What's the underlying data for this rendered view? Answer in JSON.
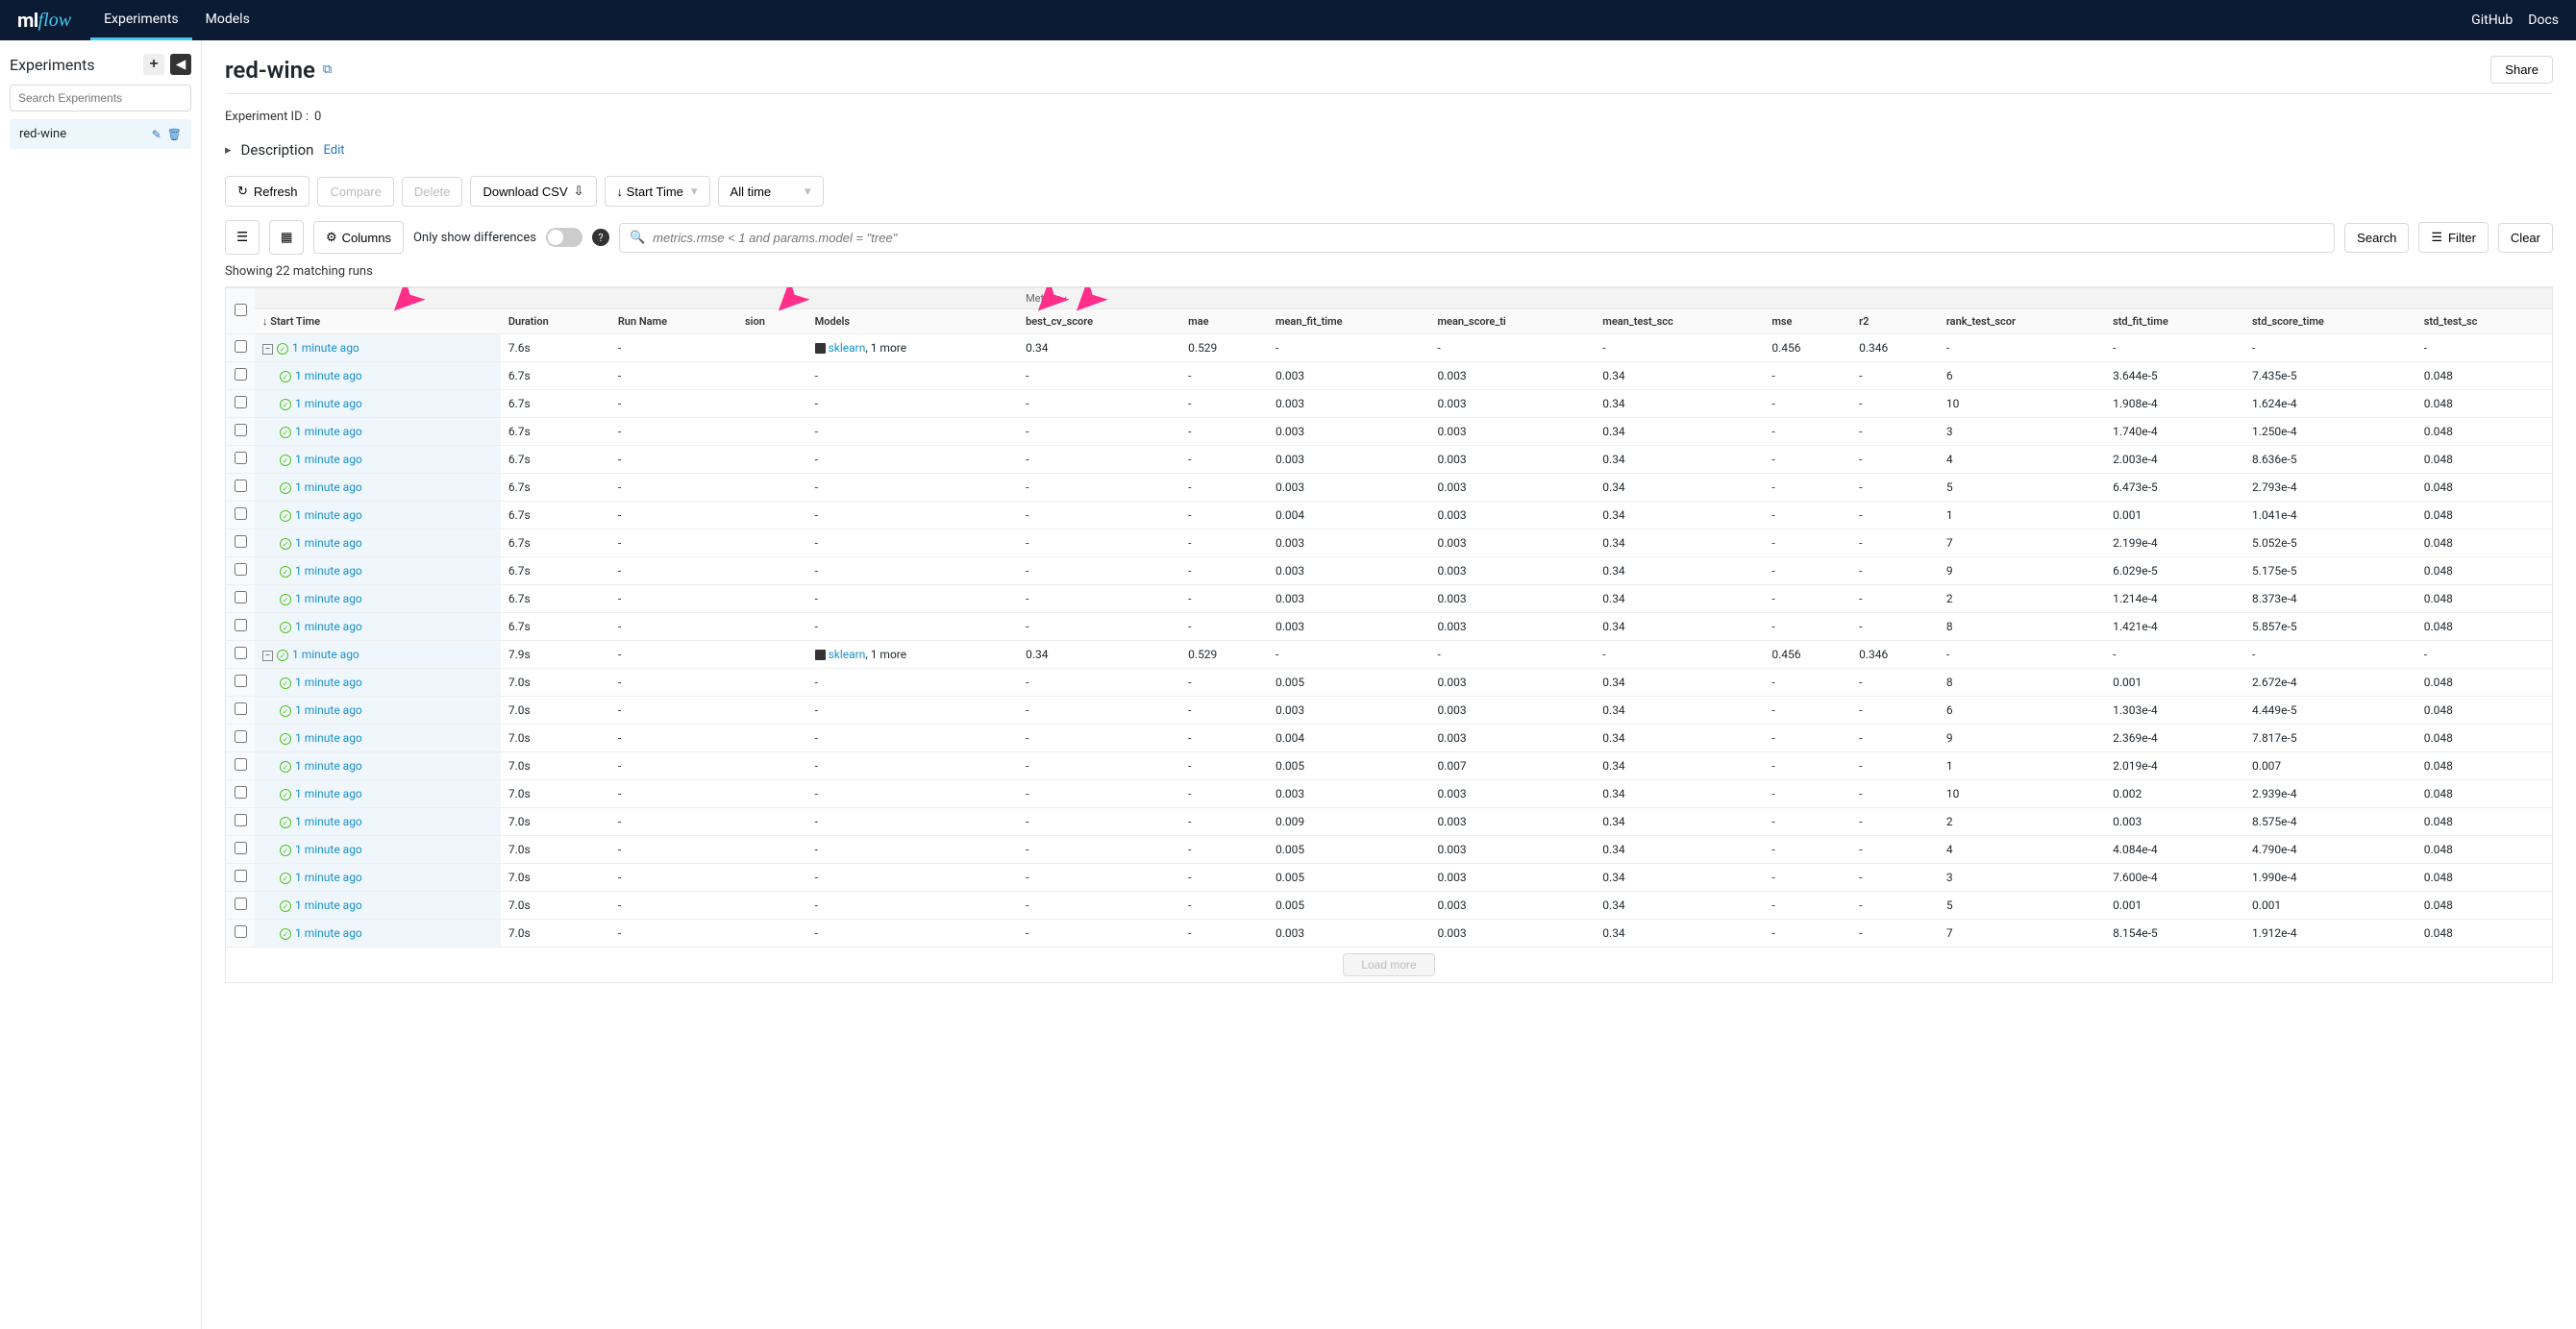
{
  "brand": {
    "ml": "ml",
    "flow": "flow"
  },
  "nav": {
    "experiments": "Experiments",
    "models": "Models",
    "github": "GitHub",
    "docs": "Docs"
  },
  "sidebar": {
    "title": "Experiments",
    "search_placeholder": "Search Experiments",
    "items": [
      {
        "name": "red-wine"
      }
    ]
  },
  "page": {
    "title": "red-wine",
    "share": "Share",
    "exp_id_label": "Experiment ID :",
    "exp_id": "0",
    "description": "Description",
    "edit": "Edit"
  },
  "toolbar": {
    "refresh": "Refresh",
    "compare": "Compare",
    "delete": "Delete",
    "download": "Download CSV",
    "sort": "Start Time",
    "timerange": "All time"
  },
  "toolbar2": {
    "columns": "Columns",
    "only_diff": "Only show differences",
    "search_placeholder": "metrics.rmse < 1 and params.model = \"tree\"",
    "search": "Search",
    "filter": "Filter",
    "clear": "Clear"
  },
  "matching": "Showing 22 matching runs",
  "groupheaders": {
    "metrics": "Metrics"
  },
  "columns": {
    "start": "Start Time",
    "duration": "Duration",
    "runname": "Run Name",
    "sion": "sion",
    "models": "Models",
    "best_cv_score": "best_cv_score",
    "mae": "mae",
    "mean_fit_time": "mean_fit_time",
    "mean_score_ti": "mean_score_ti",
    "mean_test_sco": "mean_test_scc",
    "mse": "mse",
    "r2": "r2",
    "rank_test_scor": "rank_test_scor",
    "std_fit_time": "std_fit_time",
    "std_score_time": "std_score_time",
    "std_test_sc": "std_test_sc"
  },
  "sk_label": "sklearn",
  "more_label": ", 1 more",
  "time_label": "1 minute ago",
  "loadmore": "Load more",
  "rows": [
    {
      "exp": "-",
      "dur": "7.6s",
      "models": "sk",
      "best": "0.34",
      "mae": "0.529",
      "mft": "-",
      "mst": "-",
      "mts": "-",
      "mse": "0.456",
      "r2": "0.346",
      "rank": "-",
      "sft": "-",
      "sst": "-",
      "sts": "-"
    },
    {
      "ind": 1,
      "dur": "6.7s",
      "models": "-",
      "best": "-",
      "mae": "-",
      "mft": "0.003",
      "mst": "0.003",
      "mts": "0.34",
      "mse": "-",
      "r2": "-",
      "rank": "6",
      "sft": "3.644e-5",
      "sst": "7.435e-5",
      "sts": "0.048"
    },
    {
      "ind": 1,
      "dur": "6.7s",
      "models": "-",
      "best": "-",
      "mae": "-",
      "mft": "0.003",
      "mst": "0.003",
      "mts": "0.34",
      "mse": "-",
      "r2": "-",
      "rank": "10",
      "sft": "1.908e-4",
      "sst": "1.624e-4",
      "sts": "0.048"
    },
    {
      "ind": 1,
      "dur": "6.7s",
      "models": "-",
      "best": "-",
      "mae": "-",
      "mft": "0.003",
      "mst": "0.003",
      "mts": "0.34",
      "mse": "-",
      "r2": "-",
      "rank": "3",
      "sft": "1.740e-4",
      "sst": "1.250e-4",
      "sts": "0.048"
    },
    {
      "ind": 1,
      "dur": "6.7s",
      "models": "-",
      "best": "-",
      "mae": "-",
      "mft": "0.003",
      "mst": "0.003",
      "mts": "0.34",
      "mse": "-",
      "r2": "-",
      "rank": "4",
      "sft": "2.003e-4",
      "sst": "8.636e-5",
      "sts": "0.048"
    },
    {
      "ind": 1,
      "dur": "6.7s",
      "models": "-",
      "best": "-",
      "mae": "-",
      "mft": "0.003",
      "mst": "0.003",
      "mts": "0.34",
      "mse": "-",
      "r2": "-",
      "rank": "5",
      "sft": "6.473e-5",
      "sst": "2.793e-4",
      "sts": "0.048"
    },
    {
      "ind": 1,
      "dur": "6.7s",
      "models": "-",
      "best": "-",
      "mae": "-",
      "mft": "0.004",
      "mst": "0.003",
      "mts": "0.34",
      "mse": "-",
      "r2": "-",
      "rank": "1",
      "sft": "0.001",
      "sst": "1.041e-4",
      "sts": "0.048"
    },
    {
      "ind": 1,
      "dur": "6.7s",
      "models": "-",
      "best": "-",
      "mae": "-",
      "mft": "0.003",
      "mst": "0.003",
      "mts": "0.34",
      "mse": "-",
      "r2": "-",
      "rank": "7",
      "sft": "2.199e-4",
      "sst": "5.052e-5",
      "sts": "0.048"
    },
    {
      "ind": 1,
      "dur": "6.7s",
      "models": "-",
      "best": "-",
      "mae": "-",
      "mft": "0.003",
      "mst": "0.003",
      "mts": "0.34",
      "mse": "-",
      "r2": "-",
      "rank": "9",
      "sft": "6.029e-5",
      "sst": "5.175e-5",
      "sts": "0.048"
    },
    {
      "ind": 1,
      "dur": "6.7s",
      "models": "-",
      "best": "-",
      "mae": "-",
      "mft": "0.003",
      "mst": "0.003",
      "mts": "0.34",
      "mse": "-",
      "r2": "-",
      "rank": "2",
      "sft": "1.214e-4",
      "sst": "8.373e-4",
      "sts": "0.048"
    },
    {
      "ind": 1,
      "dur": "6.7s",
      "models": "-",
      "best": "-",
      "mae": "-",
      "mft": "0.003",
      "mst": "0.003",
      "mts": "0.34",
      "mse": "-",
      "r2": "-",
      "rank": "8",
      "sft": "1.421e-4",
      "sst": "5.857e-5",
      "sts": "0.048"
    },
    {
      "exp": "-",
      "dur": "7.9s",
      "models": "sk",
      "best": "0.34",
      "mae": "0.529",
      "mft": "-",
      "mst": "-",
      "mts": "-",
      "mse": "0.456",
      "r2": "0.346",
      "rank": "-",
      "sft": "-",
      "sst": "-",
      "sts": "-"
    },
    {
      "ind": 1,
      "dur": "7.0s",
      "models": "-",
      "best": "-",
      "mae": "-",
      "mft": "0.005",
      "mst": "0.003",
      "mts": "0.34",
      "mse": "-",
      "r2": "-",
      "rank": "8",
      "sft": "0.001",
      "sst": "2.672e-4",
      "sts": "0.048"
    },
    {
      "ind": 1,
      "dur": "7.0s",
      "models": "-",
      "best": "-",
      "mae": "-",
      "mft": "0.003",
      "mst": "0.003",
      "mts": "0.34",
      "mse": "-",
      "r2": "-",
      "rank": "6",
      "sft": "1.303e-4",
      "sst": "4.449e-5",
      "sts": "0.048"
    },
    {
      "ind": 1,
      "dur": "7.0s",
      "models": "-",
      "best": "-",
      "mae": "-",
      "mft": "0.004",
      "mst": "0.003",
      "mts": "0.34",
      "mse": "-",
      "r2": "-",
      "rank": "9",
      "sft": "2.369e-4",
      "sst": "7.817e-5",
      "sts": "0.048"
    },
    {
      "ind": 1,
      "dur": "7.0s",
      "models": "-",
      "best": "-",
      "mae": "-",
      "mft": "0.005",
      "mst": "0.007",
      "mts": "0.34",
      "mse": "-",
      "r2": "-",
      "rank": "1",
      "sft": "2.019e-4",
      "sst": "0.007",
      "sts": "0.048"
    },
    {
      "ind": 1,
      "dur": "7.0s",
      "models": "-",
      "best": "-",
      "mae": "-",
      "mft": "0.003",
      "mst": "0.003",
      "mts": "0.34",
      "mse": "-",
      "r2": "-",
      "rank": "10",
      "sft": "0.002",
      "sst": "2.939e-4",
      "sts": "0.048"
    },
    {
      "ind": 1,
      "dur": "7.0s",
      "models": "-",
      "best": "-",
      "mae": "-",
      "mft": "0.009",
      "mst": "0.003",
      "mts": "0.34",
      "mse": "-",
      "r2": "-",
      "rank": "2",
      "sft": "0.003",
      "sst": "8.575e-4",
      "sts": "0.048"
    },
    {
      "ind": 1,
      "dur": "7.0s",
      "models": "-",
      "best": "-",
      "mae": "-",
      "mft": "0.005",
      "mst": "0.003",
      "mts": "0.34",
      "mse": "-",
      "r2": "-",
      "rank": "4",
      "sft": "4.084e-4",
      "sst": "4.790e-4",
      "sts": "0.048"
    },
    {
      "ind": 1,
      "dur": "7.0s",
      "models": "-",
      "best": "-",
      "mae": "-",
      "mft": "0.005",
      "mst": "0.003",
      "mts": "0.34",
      "mse": "-",
      "r2": "-",
      "rank": "3",
      "sft": "7.600e-4",
      "sst": "1.990e-4",
      "sts": "0.048"
    },
    {
      "ind": 1,
      "dur": "7.0s",
      "models": "-",
      "best": "-",
      "mae": "-",
      "mft": "0.005",
      "mst": "0.003",
      "mts": "0.34",
      "mse": "-",
      "r2": "-",
      "rank": "5",
      "sft": "0.001",
      "sst": "0.001",
      "sts": "0.048"
    },
    {
      "ind": 1,
      "dur": "7.0s",
      "models": "-",
      "best": "-",
      "mae": "-",
      "mft": "0.003",
      "mst": "0.003",
      "mts": "0.34",
      "mse": "-",
      "r2": "-",
      "rank": "7",
      "sft": "8.154e-5",
      "sst": "1.912e-4",
      "sts": "0.048"
    }
  ]
}
